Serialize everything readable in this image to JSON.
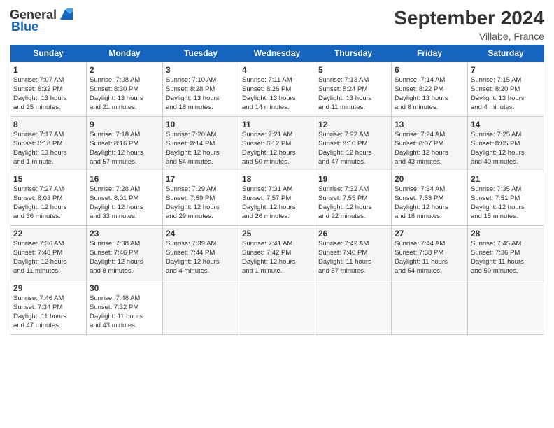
{
  "header": {
    "logo_general": "General",
    "logo_blue": "Blue",
    "title": "September 2024",
    "subtitle": "Villabe, France"
  },
  "days_of_week": [
    "Sunday",
    "Monday",
    "Tuesday",
    "Wednesday",
    "Thursday",
    "Friday",
    "Saturday"
  ],
  "weeks": [
    [
      {
        "day": "1",
        "lines": [
          "Sunrise: 7:07 AM",
          "Sunset: 8:32 PM",
          "Daylight: 13 hours",
          "and 25 minutes."
        ]
      },
      {
        "day": "2",
        "lines": [
          "Sunrise: 7:08 AM",
          "Sunset: 8:30 PM",
          "Daylight: 13 hours",
          "and 21 minutes."
        ]
      },
      {
        "day": "3",
        "lines": [
          "Sunrise: 7:10 AM",
          "Sunset: 8:28 PM",
          "Daylight: 13 hours",
          "and 18 minutes."
        ]
      },
      {
        "day": "4",
        "lines": [
          "Sunrise: 7:11 AM",
          "Sunset: 8:26 PM",
          "Daylight: 13 hours",
          "and 14 minutes."
        ]
      },
      {
        "day": "5",
        "lines": [
          "Sunrise: 7:13 AM",
          "Sunset: 8:24 PM",
          "Daylight: 13 hours",
          "and 11 minutes."
        ]
      },
      {
        "day": "6",
        "lines": [
          "Sunrise: 7:14 AM",
          "Sunset: 8:22 PM",
          "Daylight: 13 hours",
          "and 8 minutes."
        ]
      },
      {
        "day": "7",
        "lines": [
          "Sunrise: 7:15 AM",
          "Sunset: 8:20 PM",
          "Daylight: 13 hours",
          "and 4 minutes."
        ]
      }
    ],
    [
      {
        "day": "8",
        "lines": [
          "Sunrise: 7:17 AM",
          "Sunset: 8:18 PM",
          "Daylight: 13 hours",
          "and 1 minute."
        ]
      },
      {
        "day": "9",
        "lines": [
          "Sunrise: 7:18 AM",
          "Sunset: 8:16 PM",
          "Daylight: 12 hours",
          "and 57 minutes."
        ]
      },
      {
        "day": "10",
        "lines": [
          "Sunrise: 7:20 AM",
          "Sunset: 8:14 PM",
          "Daylight: 12 hours",
          "and 54 minutes."
        ]
      },
      {
        "day": "11",
        "lines": [
          "Sunrise: 7:21 AM",
          "Sunset: 8:12 PM",
          "Daylight: 12 hours",
          "and 50 minutes."
        ]
      },
      {
        "day": "12",
        "lines": [
          "Sunrise: 7:22 AM",
          "Sunset: 8:10 PM",
          "Daylight: 12 hours",
          "and 47 minutes."
        ]
      },
      {
        "day": "13",
        "lines": [
          "Sunrise: 7:24 AM",
          "Sunset: 8:07 PM",
          "Daylight: 12 hours",
          "and 43 minutes."
        ]
      },
      {
        "day": "14",
        "lines": [
          "Sunrise: 7:25 AM",
          "Sunset: 8:05 PM",
          "Daylight: 12 hours",
          "and 40 minutes."
        ]
      }
    ],
    [
      {
        "day": "15",
        "lines": [
          "Sunrise: 7:27 AM",
          "Sunset: 8:03 PM",
          "Daylight: 12 hours",
          "and 36 minutes."
        ]
      },
      {
        "day": "16",
        "lines": [
          "Sunrise: 7:28 AM",
          "Sunset: 8:01 PM",
          "Daylight: 12 hours",
          "and 33 minutes."
        ]
      },
      {
        "day": "17",
        "lines": [
          "Sunrise: 7:29 AM",
          "Sunset: 7:59 PM",
          "Daylight: 12 hours",
          "and 29 minutes."
        ]
      },
      {
        "day": "18",
        "lines": [
          "Sunrise: 7:31 AM",
          "Sunset: 7:57 PM",
          "Daylight: 12 hours",
          "and 26 minutes."
        ]
      },
      {
        "day": "19",
        "lines": [
          "Sunrise: 7:32 AM",
          "Sunset: 7:55 PM",
          "Daylight: 12 hours",
          "and 22 minutes."
        ]
      },
      {
        "day": "20",
        "lines": [
          "Sunrise: 7:34 AM",
          "Sunset: 7:53 PM",
          "Daylight: 12 hours",
          "and 18 minutes."
        ]
      },
      {
        "day": "21",
        "lines": [
          "Sunrise: 7:35 AM",
          "Sunset: 7:51 PM",
          "Daylight: 12 hours",
          "and 15 minutes."
        ]
      }
    ],
    [
      {
        "day": "22",
        "lines": [
          "Sunrise: 7:36 AM",
          "Sunset: 7:48 PM",
          "Daylight: 12 hours",
          "and 11 minutes."
        ]
      },
      {
        "day": "23",
        "lines": [
          "Sunrise: 7:38 AM",
          "Sunset: 7:46 PM",
          "Daylight: 12 hours",
          "and 8 minutes."
        ]
      },
      {
        "day": "24",
        "lines": [
          "Sunrise: 7:39 AM",
          "Sunset: 7:44 PM",
          "Daylight: 12 hours",
          "and 4 minutes."
        ]
      },
      {
        "day": "25",
        "lines": [
          "Sunrise: 7:41 AM",
          "Sunset: 7:42 PM",
          "Daylight: 12 hours",
          "and 1 minute."
        ]
      },
      {
        "day": "26",
        "lines": [
          "Sunrise: 7:42 AM",
          "Sunset: 7:40 PM",
          "Daylight: 11 hours",
          "and 57 minutes."
        ]
      },
      {
        "day": "27",
        "lines": [
          "Sunrise: 7:44 AM",
          "Sunset: 7:38 PM",
          "Daylight: 11 hours",
          "and 54 minutes."
        ]
      },
      {
        "day": "28",
        "lines": [
          "Sunrise: 7:45 AM",
          "Sunset: 7:36 PM",
          "Daylight: 11 hours",
          "and 50 minutes."
        ]
      }
    ],
    [
      {
        "day": "29",
        "lines": [
          "Sunrise: 7:46 AM",
          "Sunset: 7:34 PM",
          "Daylight: 11 hours",
          "and 47 minutes."
        ]
      },
      {
        "day": "30",
        "lines": [
          "Sunrise: 7:48 AM",
          "Sunset: 7:32 PM",
          "Daylight: 11 hours",
          "and 43 minutes."
        ]
      },
      null,
      null,
      null,
      null,
      null
    ]
  ]
}
